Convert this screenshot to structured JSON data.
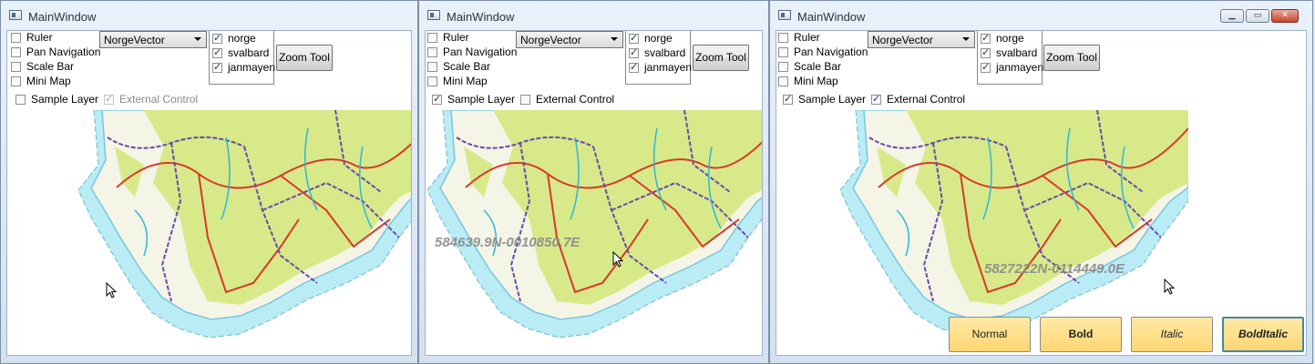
{
  "windows": [
    {
      "title": "MainWindow",
      "options": [
        "Ruler",
        "Pan Navigation",
        "Scale Bar",
        "Mini Map"
      ],
      "options_checked": [
        false,
        false,
        false,
        false
      ],
      "map_select": "NorgeVector",
      "layers": [
        {
          "label": "norge",
          "checked": true
        },
        {
          "label": "svalbard",
          "checked": true
        },
        {
          "label": "janmayen",
          "checked": true
        }
      ],
      "zoom_tool": "Zoom Tool",
      "sample_layer": {
        "label": "Sample Layer",
        "checked": false
      },
      "external_control": {
        "label": "External Control",
        "checked": true,
        "disabled": true
      },
      "coordinate": ""
    },
    {
      "title": "MainWindow",
      "options": [
        "Ruler",
        "Pan Navigation",
        "Scale Bar",
        "Mini Map"
      ],
      "options_checked": [
        false,
        false,
        false,
        false
      ],
      "map_select": "NorgeVector",
      "layers": [
        {
          "label": "norge",
          "checked": true
        },
        {
          "label": "svalbard",
          "checked": true
        },
        {
          "label": "janmayen",
          "checked": true
        }
      ],
      "zoom_tool": "Zoom Tool",
      "sample_layer": {
        "label": "Sample Layer",
        "checked": true
      },
      "external_control": {
        "label": "External Control",
        "checked": false,
        "disabled": false
      },
      "coordinate": "584639.9N-0010850.7E"
    },
    {
      "title": "MainWindow",
      "options": [
        "Ruler",
        "Pan Navigation",
        "Scale Bar",
        "Mini Map"
      ],
      "options_checked": [
        false,
        false,
        false,
        false
      ],
      "map_select": "NorgeVector",
      "layers": [
        {
          "label": "norge",
          "checked": true
        },
        {
          "label": "svalbard",
          "checked": true
        },
        {
          "label": "janmayen",
          "checked": true
        }
      ],
      "zoom_tool": "Zoom Tool",
      "sample_layer": {
        "label": "Sample Layer",
        "checked": true
      },
      "external_control": {
        "label": "External Control",
        "checked": true,
        "disabled": false
      },
      "coordinate": "5827222N-0114449.0E",
      "window_controls": [
        "minimize",
        "maximize",
        "close"
      ],
      "font_buttons": [
        "Normal",
        "Bold",
        "Italic",
        "BoldItalic"
      ]
    }
  ],
  "colors": {
    "land": "#d8e98a",
    "lowland": "#f4f5e6",
    "water": "#b9ecf4",
    "roads": "#d8382b",
    "borders": "#6b4aa8",
    "rivers": "#2ab7d9",
    "font_button": "#ffd772"
  }
}
